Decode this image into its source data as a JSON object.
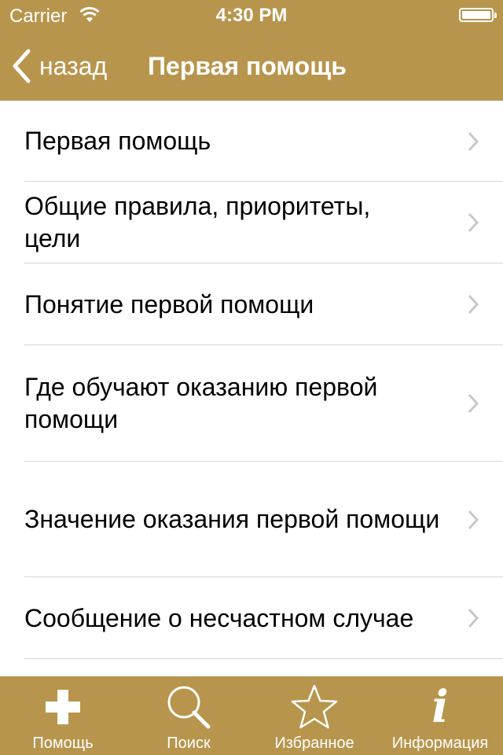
{
  "status_bar": {
    "carrier": "Carrier",
    "time": "4:30 PM"
  },
  "nav": {
    "back_label": "назад",
    "title": "Первая помощь"
  },
  "list": {
    "items": [
      {
        "label": "Первая помощь"
      },
      {
        "label": "Общие правила, приоритеты, цели"
      },
      {
        "label": "Понятие первой помощи"
      },
      {
        "label": "Где обучают оказанию первой помощи"
      },
      {
        "label": "Значение оказания первой помощи"
      },
      {
        "label": "Сообщение о несчастном случае"
      }
    ]
  },
  "tabbar": {
    "tabs": [
      {
        "label": "Помощь",
        "icon": "plus-icon"
      },
      {
        "label": "Поиск",
        "icon": "search-icon"
      },
      {
        "label": "Избранное",
        "icon": "star-icon"
      },
      {
        "label": "Информация",
        "icon": "info-icon"
      }
    ]
  },
  "colors": {
    "bar": "#b8954c",
    "text": "#000000",
    "separator": "#d6d6d6",
    "chevron": "#c7c7cc"
  }
}
